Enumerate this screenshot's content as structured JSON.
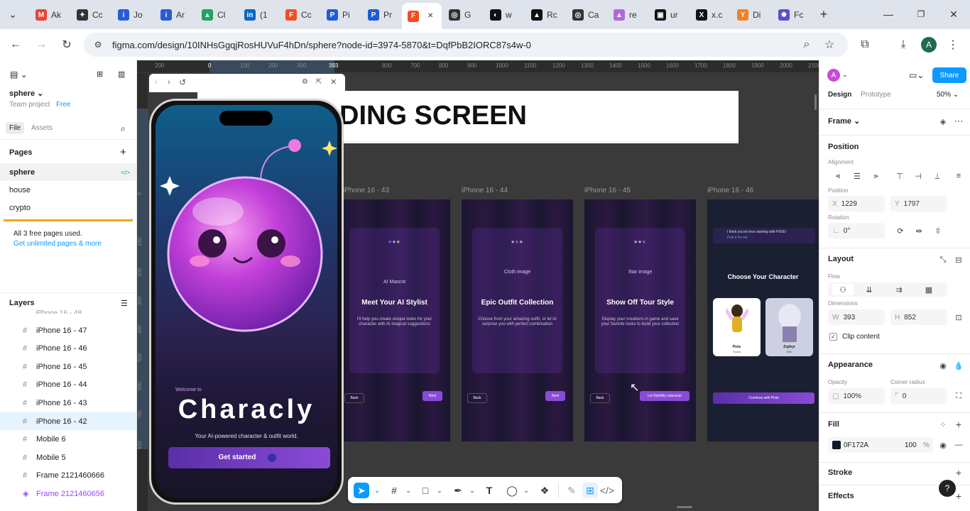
{
  "browser": {
    "tabs": [
      {
        "label": "Ak",
        "icon": "gmail-icon",
        "color": "#ea4335",
        "glyph": "M"
      },
      {
        "label": "Cc",
        "icon": "chatbot-icon",
        "color": "#333333",
        "glyph": "✦"
      },
      {
        "label": "Jo",
        "icon": "info-icon",
        "color": "#2a5bd7",
        "glyph": "i"
      },
      {
        "label": "Ar",
        "icon": "info-icon",
        "color": "#2a5bd7",
        "glyph": "i"
      },
      {
        "label": "Cl",
        "icon": "google-drive-icon",
        "color": "#1fa463",
        "glyph": "▲"
      },
      {
        "label": "(1",
        "icon": "linkedin-icon",
        "color": "#0a66c2",
        "glyph": "in"
      },
      {
        "label": "Cc",
        "icon": "figma-icon",
        "color": "#f24e1e",
        "glyph": "F"
      },
      {
        "label": "Pi",
        "icon": "app-icon",
        "color": "#1e5bd8",
        "glyph": "P"
      },
      {
        "label": "Pr",
        "icon": "app-icon",
        "color": "#1e5bd8",
        "glyph": "P"
      },
      {
        "label": "",
        "icon": "figma-icon",
        "color": "#f24e1e",
        "glyph": "F",
        "active": true
      },
      {
        "label": "G",
        "icon": "openai-icon",
        "color": "#333333",
        "glyph": "◎"
      },
      {
        "label": "w",
        "icon": "circle-icon",
        "color": "#111111",
        "glyph": "◐"
      },
      {
        "label": "Rc",
        "icon": "app-icon",
        "color": "#111111",
        "glyph": "▲"
      },
      {
        "label": "Ca",
        "icon": "openai-icon",
        "color": "#333333",
        "glyph": "◎"
      },
      {
        "label": "re",
        "icon": "app-icon",
        "color": "#b06ad8",
        "glyph": "▲"
      },
      {
        "label": "ur",
        "icon": "app-icon",
        "color": "#111111",
        "glyph": "▣"
      },
      {
        "label": "x.c",
        "icon": "x-icon",
        "color": "#111111",
        "glyph": "X"
      },
      {
        "label": "Di",
        "icon": "app-icon",
        "color": "#f48024",
        "glyph": "Y"
      },
      {
        "label": "Fc",
        "icon": "gear-icon",
        "color": "#5a4fcf",
        "glyph": "✹"
      }
    ],
    "url": "figma.com/design/10INHsGgqjRosHUVuF4hDn/sphere?node-id=3974-5870&t=DqfPbB2IORC87s4w-0",
    "profile_initial": "A"
  },
  "left": {
    "file_name": "sphere",
    "team_project": "Team project",
    "plan": "Free",
    "tab_file": "File",
    "tab_assets": "Assets",
    "pages_heading": "Pages",
    "pages": [
      "sphere",
      "house",
      "crypto"
    ],
    "notice_text": "All 3 free pages used.",
    "notice_link": "Get unlimited pages & more",
    "layers_heading": "Layers",
    "layers": [
      {
        "name": "iPhone 16 - 47"
      },
      {
        "name": "iPhone 16 - 46"
      },
      {
        "name": "iPhone 16 - 45"
      },
      {
        "name": "iPhone 16 - 44"
      },
      {
        "name": "iPhone 16 - 43"
      },
      {
        "name": "iPhone 16 - 42",
        "selected": true
      },
      {
        "name": "Mobile 6"
      },
      {
        "name": "Mobile 5"
      },
      {
        "name": "Frame 2121460666"
      },
      {
        "name": "Frame 2121460656",
        "component": true
      }
    ]
  },
  "canvas": {
    "ruler_top": [
      "200",
      "0",
      "100",
      "200",
      "300",
      "393",
      "800",
      "700",
      "800",
      "900",
      "1000",
      "1100",
      "1200",
      "1300",
      "1400",
      "1500",
      "1600",
      "1700",
      "1800",
      "1900",
      "2000",
      "2100"
    ],
    "ruler_left": [
      "0",
      "100",
      "200",
      "300",
      "400",
      "500",
      "600",
      "700",
      "852"
    ],
    "banner_text": "DING SCREEN",
    "preview": {
      "welcome": "Welcome to",
      "app_name": "Characly",
      "tagline": "Your AI-powered character & outfit world.",
      "cta": "Get started"
    },
    "frames": [
      {
        "label": "iPhone 16 - 43",
        "caption": "AI Mascot",
        "title": "Meet Your AI Stylist",
        "desc": "I'll help you create unique looks for your character with AI magical suggestions",
        "back": "Back",
        "next": "Next"
      },
      {
        "label": "iPhone 16 - 44",
        "caption": "Cloth image",
        "title": "Epic Outfit Collection",
        "desc": "Choose from your amazing outfit, or let AI surprise you with perfect combination",
        "back": "Back",
        "next": "Next"
      },
      {
        "label": "iPhone 16 - 45",
        "caption": "Star image",
        "title": "Show Off Tour Style",
        "desc": "Display your creations in game and save your favorite looks to build your collection",
        "back": "Back",
        "next": "Let StyleMy character"
      },
      {
        "label": "iPhone 16 - 46",
        "bubble": "I think you've love starting with PIXIE!",
        "bubble_link": "Pick it for me",
        "title": "Choose Your Character",
        "char1": "Pixie",
        "char1_role": "Studio",
        "char2": "Zephyr",
        "char2_role": "Elite",
        "cta": "Continue with Pixie"
      }
    ]
  },
  "right": {
    "avatar_initial": "A",
    "share": "Share",
    "tab_design": "Design",
    "tab_prototype": "Prototype",
    "zoom": "50%",
    "frame_label": "Frame",
    "position_heading": "Position",
    "alignment_label": "Alignment",
    "position_label": "Position",
    "x_label": "X",
    "x_value": "1229",
    "y_label": "Y",
    "y_value": "1797",
    "rotation_label": "Rotation",
    "rotation_value": "0°",
    "layout_heading": "Layout",
    "flow_label": "Flow",
    "dimensions_label": "Dimensions",
    "w_label": "W",
    "w_value": "393",
    "h_label": "H",
    "h_value": "852",
    "clip_content": "Clip content",
    "appearance_heading": "Appearance",
    "opacity_label": "Opacity",
    "opacity_value": "100%",
    "corner_label": "Corner radius",
    "corner_value": "0",
    "fill_heading": "Fill",
    "fill_hex": "0F172A",
    "fill_opacity": "100",
    "fill_pct": "%",
    "fill_color": "#0F172A",
    "stroke_heading": "Stroke",
    "effects_heading": "Effects",
    "help": "?"
  }
}
